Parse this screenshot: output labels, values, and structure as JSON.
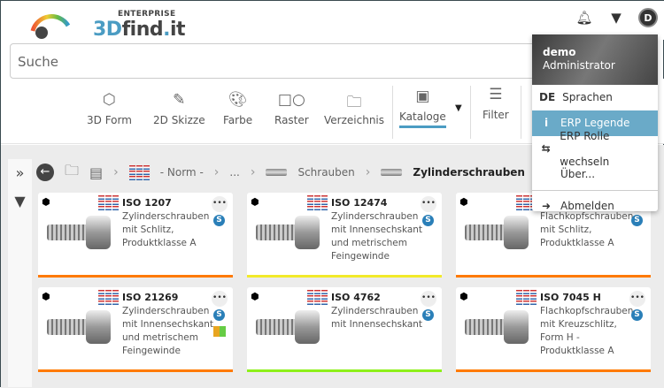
{
  "header": {
    "logo_top": "ENTERPRISE",
    "logo_3d": "3D",
    "logo_find": "find",
    "logo_dot": ".",
    "logo_it": "it",
    "avatar_initial": "D"
  },
  "search": {
    "placeholder": "Suche"
  },
  "toolbar": {
    "items": [
      {
        "label": "3D Form",
        "icon": "cube-icon"
      },
      {
        "label": "2D Skizze",
        "icon": "pencil-icon"
      },
      {
        "label": "Farbe",
        "icon": "palette-icon"
      },
      {
        "label": "Raster",
        "icon": "shapes-icon"
      },
      {
        "label": "Verzeichnis",
        "icon": "folder-icon"
      },
      {
        "label": "Kataloge",
        "icon": "catalog-icon"
      },
      {
        "label": "Filter",
        "icon": "sliders-icon"
      }
    ]
  },
  "breadcrumb": {
    "items": [
      "- Norm -",
      "...",
      "Schrauben",
      "Zylinderschrauben"
    ]
  },
  "cards": [
    {
      "title": "ISO 1207",
      "desc": "Zylinderschrauben mit Schlitz, Produktklasse A",
      "bar": "#ff7a00",
      "erp": false
    },
    {
      "title": "ISO 12474",
      "desc": "Zylinderschrauben mit Innensechskant und metrischem Feingewinde",
      "bar": "#f2ea2a",
      "erp": false
    },
    {
      "title": "ISO 1207",
      "desc": "Flachkopfschrauben mit Schlitz, Produktklasse A",
      "bar": "#ff7a00",
      "erp": false
    },
    {
      "title": "ISO 21269",
      "desc": "Zylinderschrauben mit Innensechskant und metrischem Feingewinde",
      "bar": "#ff7a00",
      "erp": true
    },
    {
      "title": "ISO 4762",
      "desc": "Zylinderschrauben mit Innensechskant",
      "bar": "#8ef01a",
      "erp": false
    },
    {
      "title": "ISO 7045 H",
      "desc": "Flachkopfschrauben mit Kreuzschlitz, Form H - Produktklasse A",
      "bar": "#ff7a00",
      "erp": false
    }
  ],
  "card_more": "•••",
  "card_badge": "S",
  "menu": {
    "user": "demo",
    "role": "Administrator",
    "lang_code": "DE",
    "lang": "Sprachen",
    "legend": "ERP Legende",
    "role_switch": "ERP Rolle wechseln",
    "about": "Über...",
    "logout": "Abmelden"
  }
}
